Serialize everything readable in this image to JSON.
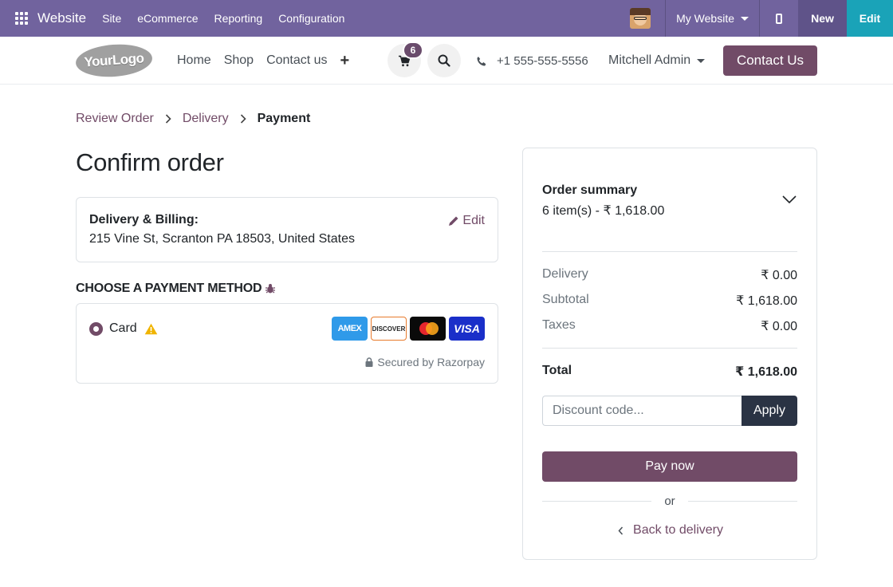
{
  "adminbar": {
    "brand": "Website",
    "menu": [
      "Site",
      "eCommerce",
      "Reporting",
      "Configuration"
    ],
    "website_selector": "My Website",
    "new_label": "New",
    "edit_label": "Edit"
  },
  "header": {
    "logo_text": "YourLogo",
    "nav": [
      "Home",
      "Shop",
      "Contact us"
    ],
    "cart_count": "6",
    "phone": "+1 555-555-5556",
    "user": "Mitchell Admin",
    "contact_button": "Contact Us"
  },
  "breadcrumb": {
    "steps": [
      "Review Order",
      "Delivery",
      "Payment"
    ]
  },
  "main": {
    "title": "Confirm order",
    "address_card": {
      "label": "Delivery & Billing:",
      "value": "215 Vine St, Scranton PA 18503, United States",
      "edit_label": "Edit"
    },
    "payment_heading": "CHOOSE A PAYMENT METHOD",
    "payment": {
      "card_label": "Card",
      "brands": [
        "AMEX",
        "DISCOVER",
        "Mastercard",
        "VISA"
      ],
      "secured_text": "Secured by Razorpay"
    }
  },
  "summary": {
    "title": "Order summary",
    "subtitle": "6 item(s) -  ₹ 1,618.00",
    "rows": [
      {
        "label": "Delivery",
        "value": "₹ 0.00"
      },
      {
        "label": "Subtotal",
        "value": "₹ 1,618.00"
      },
      {
        "label": "Taxes",
        "value": "₹ 0.00"
      }
    ],
    "total_label": "Total",
    "total_value": "₹ 1,618.00",
    "discount_placeholder": "Discount code...",
    "apply_label": "Apply",
    "pay_label": "Pay now",
    "or_label": "or",
    "back_label": "Back to delivery"
  },
  "colors": {
    "adminbar": "#71639e",
    "primary": "#714b67",
    "edit": "#1aa3b8",
    "apply": "#2a3344"
  }
}
